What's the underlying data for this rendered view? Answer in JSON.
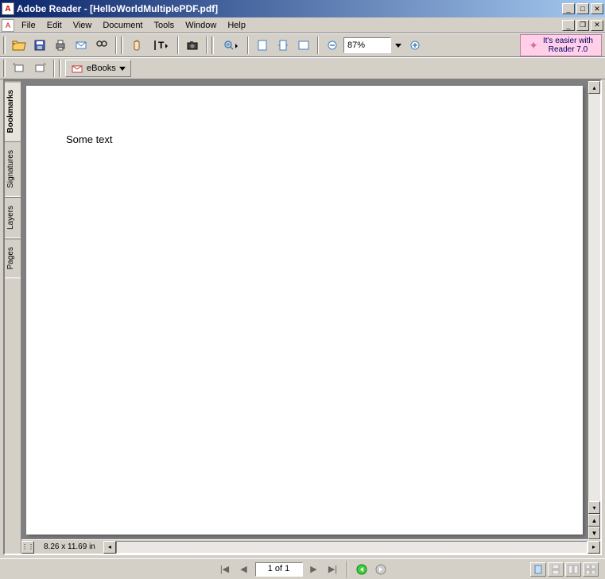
{
  "titlebar": {
    "app": "Adobe Reader",
    "filename": "[HelloWorldMultiplePDF.pdf]"
  },
  "menus": {
    "file": "File",
    "edit": "Edit",
    "view": "View",
    "document": "Document",
    "tools": "Tools",
    "window": "Window",
    "help": "Help"
  },
  "toolbar": {
    "zoom_value": "87%",
    "ebooks_label": "eBooks"
  },
  "promo": {
    "line1": "It's easier with",
    "line2": "Reader 7.0"
  },
  "nav_tabs": {
    "bookmarks": "Bookmarks",
    "signatures": "Signatures",
    "layers": "Layers",
    "pages": "Pages"
  },
  "document": {
    "content": "Some text"
  },
  "status": {
    "page_size": "8.26 x 11.69 in",
    "page_of": "1 of 1"
  }
}
